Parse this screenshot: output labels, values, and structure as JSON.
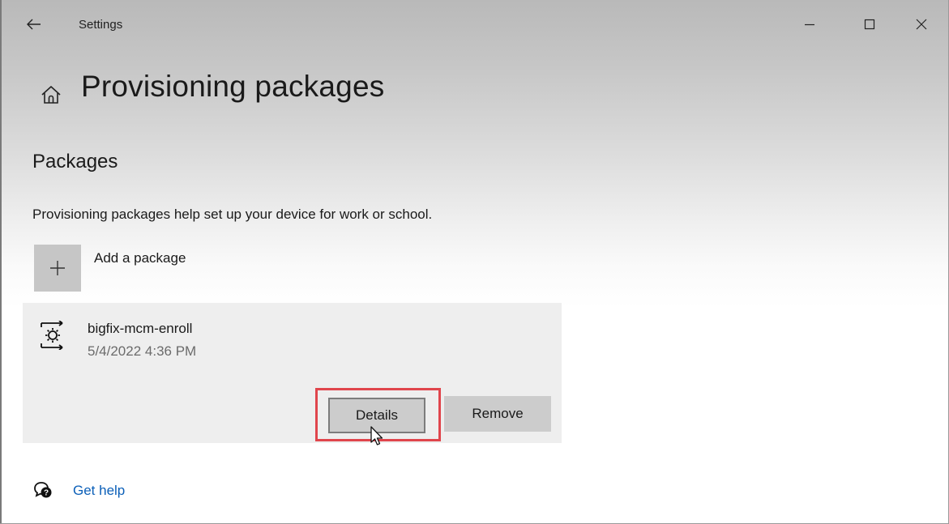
{
  "window": {
    "app_title": "Settings",
    "controls": {
      "back_icon": "arrow-left-icon",
      "minimize_icon": "minimize-icon",
      "maximize_icon": "maximize-icon",
      "close_icon": "close-icon"
    }
  },
  "page": {
    "home_icon": "home-icon",
    "title": "Provisioning packages",
    "section_title": "Packages",
    "description": "Provisioning packages help set up your device for work or school."
  },
  "add_package": {
    "icon": "plus-icon",
    "label": "Add a package"
  },
  "packages": [
    {
      "icon": "provisioning-package-icon",
      "name": "bigfix-mcm-enroll",
      "date": "5/4/2022 4:36 PM",
      "details_label": "Details",
      "remove_label": "Remove"
    }
  ],
  "help": {
    "icon": "get-help-icon",
    "label": "Get help"
  },
  "colors": {
    "highlight": "#e0454c",
    "link": "#0b5fb8",
    "button_bg": "#cccccc",
    "card_bg": "#eeeeee"
  }
}
